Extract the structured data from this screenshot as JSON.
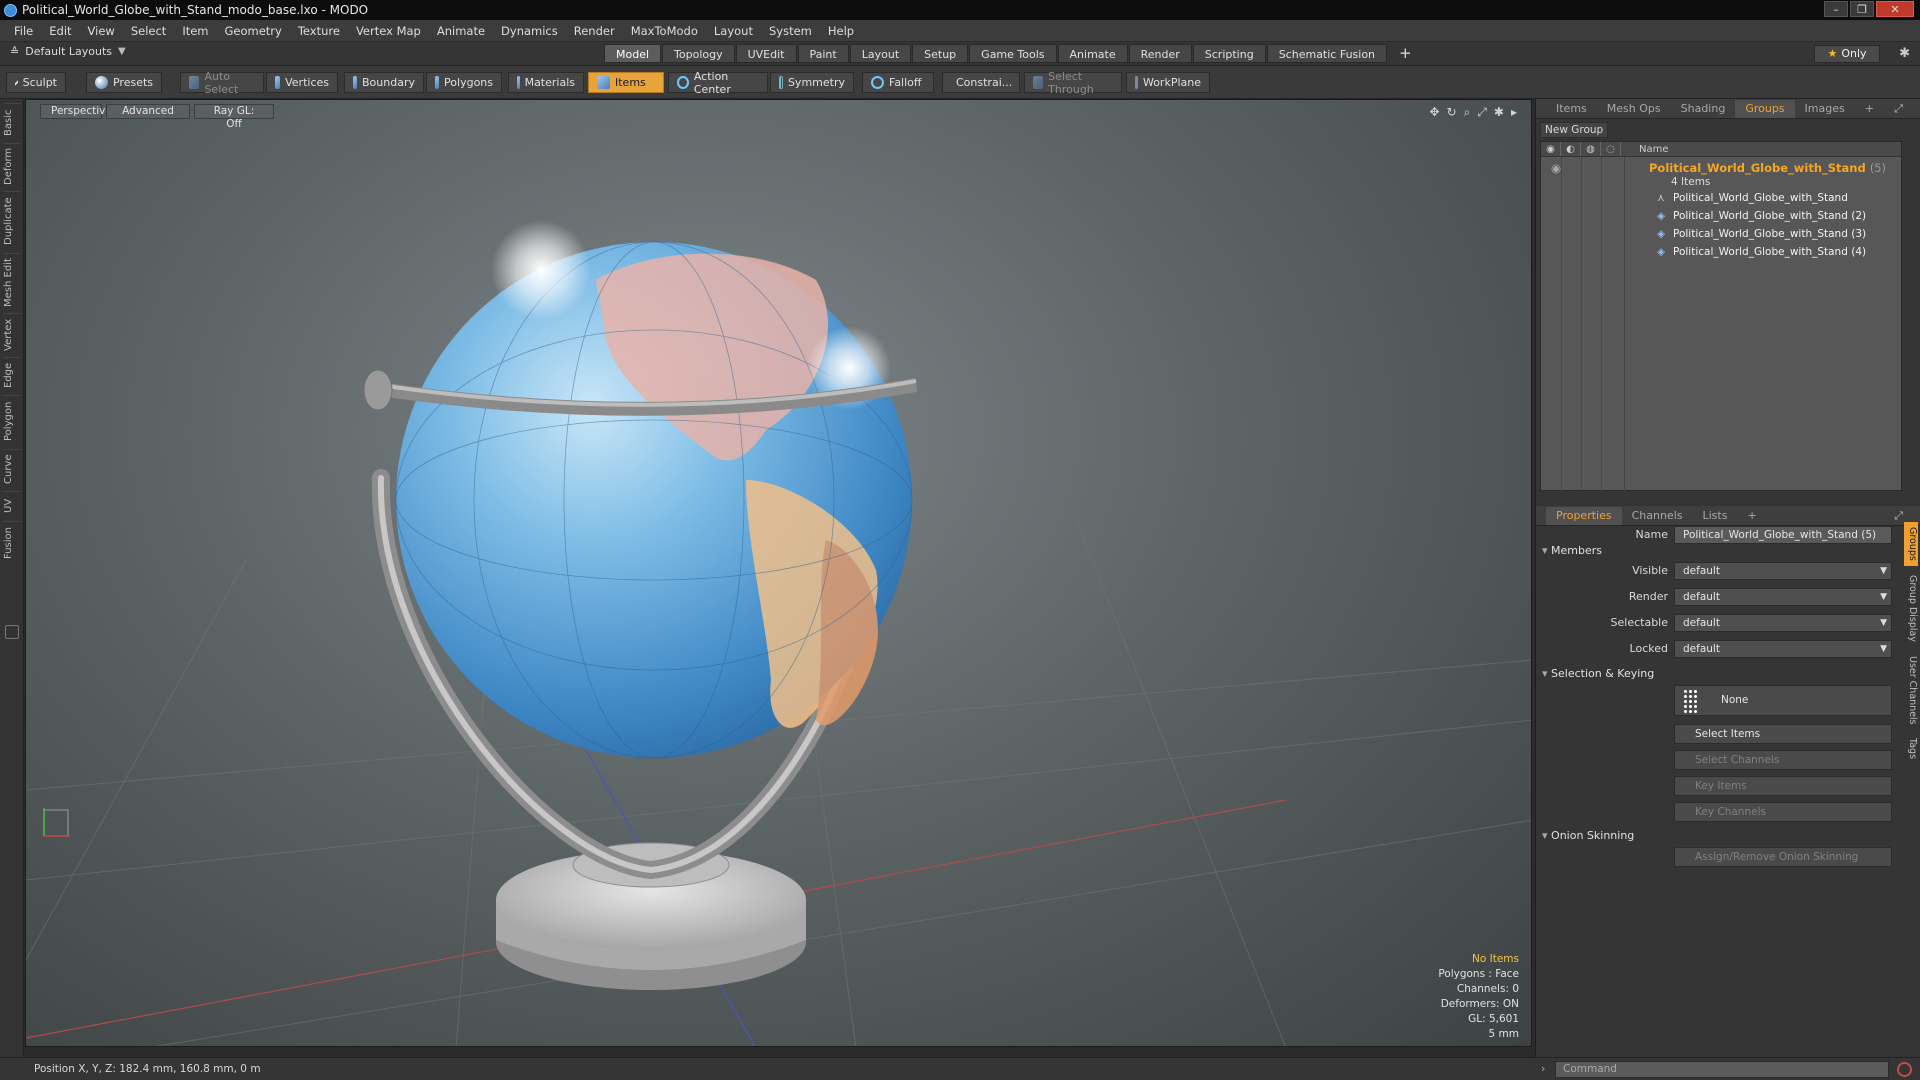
{
  "window": {
    "title": "Political_World_Globe_with_Stand_modo_base.lxo - MODO"
  },
  "menu": [
    "File",
    "Edit",
    "View",
    "Select",
    "Item",
    "Geometry",
    "Texture",
    "Vertex Map",
    "Animate",
    "Dynamics",
    "Render",
    "MaxToModo",
    "Layout",
    "System",
    "Help"
  ],
  "modebar": {
    "layouts": "Default Layouts",
    "tabs": [
      "Model",
      "Topology",
      "UVEdit",
      "Paint",
      "Layout",
      "Setup",
      "Game Tools",
      "Animate",
      "Render",
      "Scripting",
      "Schematic Fusion"
    ],
    "active_tab": "Model",
    "only": "Only"
  },
  "toolbar": {
    "sculpt": "Sculpt",
    "presets": "Presets",
    "auto_select": "Auto Select",
    "vertices": "Vertices",
    "boundary": "Boundary",
    "polygons": "Polygons",
    "materials": "Materials",
    "items": "Items",
    "action_center": "Action Center",
    "symmetry": "Symmetry",
    "falloff": "Falloff",
    "constraints": "Constrai...",
    "select_through": "Select Through",
    "workplane": "WorkPlane"
  },
  "left_tabs": [
    "Basic",
    "Deform",
    "Duplicate",
    "Mesh Edit",
    "Vertex",
    "Edge",
    "Polygon",
    "Curve",
    "UV",
    "Fusion"
  ],
  "viewport": {
    "view": "Perspective",
    "shading": "Advanced",
    "raygl": "Ray GL: Off",
    "stats": {
      "items": "No Items",
      "polygons": "Polygons : Face",
      "channels": "Channels: 0",
      "deformers": "Deformers: ON",
      "gl": "GL: 5,601",
      "scale": "5 mm"
    }
  },
  "statusbar": {
    "position": "Position X, Y, Z:  182.4 mm, 160.8 mm, 0 m"
  },
  "groups_panel": {
    "tabs": [
      "Items",
      "Mesh Ops",
      "Shading",
      "Groups",
      "Images"
    ],
    "active_tab": "Groups",
    "new_group": "New Group",
    "name_header": "Name",
    "group": {
      "name": "Political_World_Globe_with_Stand",
      "count": "(5)",
      "items_count": "4 Items"
    },
    "children": [
      "Political_World_Globe_with_Stand",
      "Political_World_Globe_with_Stand (2)",
      "Political_World_Globe_with_Stand (3)",
      "Political_World_Globe_with_Stand (4)"
    ],
    "side_tabs": [
      "Groups",
      "Group Display",
      "User Channels",
      "Tags"
    ]
  },
  "properties": {
    "tabs": [
      "Properties",
      "Channels",
      "Lists"
    ],
    "active_tab": "Properties",
    "name_label": "Name",
    "name_value": "Political_World_Globe_with_Stand (5)",
    "members_section": "Members",
    "visible_label": "Visible",
    "visible_value": "default",
    "render_label": "Render",
    "render_value": "default",
    "selectable_label": "Selectable",
    "selectable_value": "default",
    "locked_label": "Locked",
    "locked_value": "default",
    "keying_section": "Selection & Keying",
    "none": "None",
    "select_items": "Select Items",
    "select_channels": "Select Channels",
    "key_items": "Key Items",
    "key_channels": "Key Channels",
    "onion_section": "Onion Skinning",
    "onion_btn": "Assign/Remove Onion Skinning"
  },
  "command": {
    "placeholder": "Command"
  },
  "colors": {
    "accent": "#f0a030",
    "items_active": "#e8a33a"
  }
}
